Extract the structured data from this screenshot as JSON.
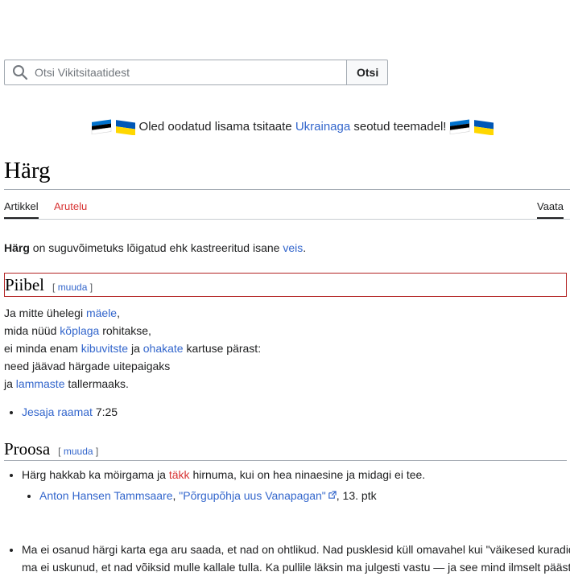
{
  "search": {
    "placeholder": "Otsi Vikitsitaatidest",
    "button_label": "Otsi"
  },
  "banner": {
    "text_before": "Oled oodatud lisama tsitaate ",
    "link": "Ukrainaga",
    "text_after": " seotud teemadel!",
    "flag_colors": {
      "estonia": [
        "#0072ce",
        "#000000",
        "#ffffff"
      ],
      "ukraine": [
        "#0057b7",
        "#ffd700"
      ]
    }
  },
  "page": {
    "title": "Härg"
  },
  "tabs": {
    "article": "Artikkel",
    "talk": "Arutelu",
    "view": "Vaata"
  },
  "intro": {
    "bold": "Härg",
    "text": " on suguvõimetuks lõigatud ehk kastreeritud isane ",
    "link": "veis",
    "end": "."
  },
  "sections": {
    "piibel": {
      "title": "Piibel",
      "edit_open": "[ ",
      "edit_label": "muuda",
      "edit_close": " ]"
    },
    "proosa": {
      "title": "Proosa",
      "edit_open": "[ ",
      "edit_label": "muuda",
      "edit_close": " ]"
    }
  },
  "poem": {
    "line1_a": "Ja mitte ühelegi ",
    "line1_link": "mäele",
    "line1_b": ",",
    "line2_a": "mida nüüd ",
    "line2_link": "kõplaga",
    "line2_b": " rohitakse,",
    "line3_a": "ei minda enam ",
    "line3_link1": "kibuvitste",
    "line3_b": " ja ",
    "line3_link2": "ohakate",
    "line3_c": " kartuse pärast:",
    "line4": "need jäävad härgade uitepaigaks",
    "line5_a": "ja ",
    "line5_link": "lammaste",
    "line5_b": " tallermaaks."
  },
  "source1": {
    "link": "Jesaja raamat",
    "ref": " 7:25"
  },
  "proosa": {
    "q1_a": "Härg hakkab ka möirgama ja ",
    "q1_redlink": "täkk",
    "q1_b": " hirnuma, kui on hea ninaesine ja midagi ei tee.",
    "q1_src_author": "Anton Hansen Tammsaare",
    "q1_src_sep": ", ",
    "q1_src_work": "\"Põrgupõhja uus Vanapagan\"",
    "q1_src_rest": ", 13. ptk",
    "q2_line1": "Ma ei osanud härgi karta ega aru saada, et nad on ohtlikud. Nad pusklesid küll omavahel kui \"väikesed kuradid",
    "q2_line2": "ma ei uskunud, et nad võiksid mulle kallale tulla. Ka pullile läksin ma julgesti vastu — ja see mind ilmselt päästi"
  },
  "icons": {
    "search": "magnifier-icon",
    "external": "external-link-icon"
  }
}
